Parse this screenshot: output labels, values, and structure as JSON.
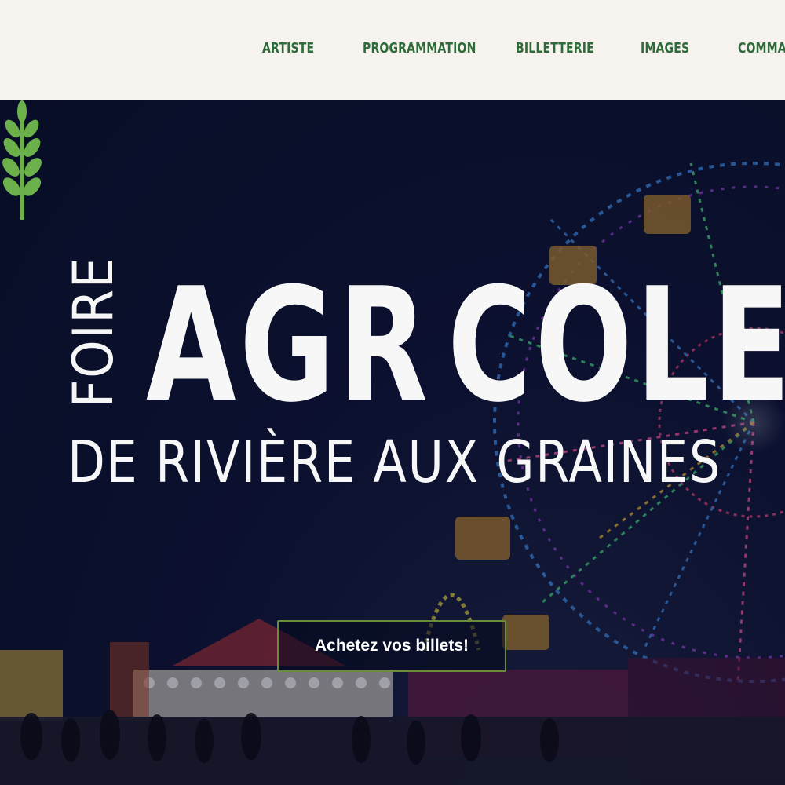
{
  "nav": {
    "items": [
      {
        "label": "ARTISTE"
      },
      {
        "label": "PROGRAMMATION"
      },
      {
        "label": "BILLETTERIE"
      },
      {
        "label": "IMAGES"
      },
      {
        "label": "COMMANDITAIRES"
      }
    ]
  },
  "hero": {
    "title_small": "FOIRE",
    "title_part1": "AGR",
    "title_part2": "COLE",
    "subtitle": "DE RIVIÈRE AUX GRAINES",
    "logo_icon": "wheat-icon",
    "cta_label": "Achetez vos billets!"
  },
  "colors": {
    "nav_text": "#2f6b3a",
    "topbar_bg": "#f6f3ee",
    "wheat_green": "#6bb04a",
    "cta_border": "#6a8d3a",
    "hero_bg": "#0c1230"
  }
}
